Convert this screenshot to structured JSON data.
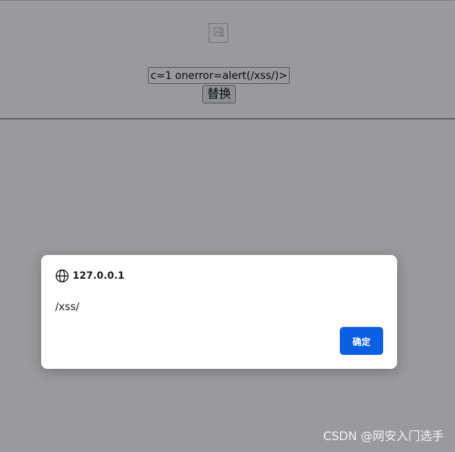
{
  "page": {
    "input_value": "c=1 onerror=alert(/xss/)>",
    "replace_button": "替换"
  },
  "dialog": {
    "origin": "127.0.0.1",
    "message": "/xss/",
    "ok_button": "确定"
  },
  "watermark": {
    "text": "CSDN @网安入门选手"
  },
  "colors": {
    "overlay": "#9a9a9c",
    "dialog_bg": "#ffffff",
    "ok_button": "#0b5fe3"
  },
  "icons": {
    "broken_image": "broken-image-icon",
    "globe": "globe-icon"
  }
}
